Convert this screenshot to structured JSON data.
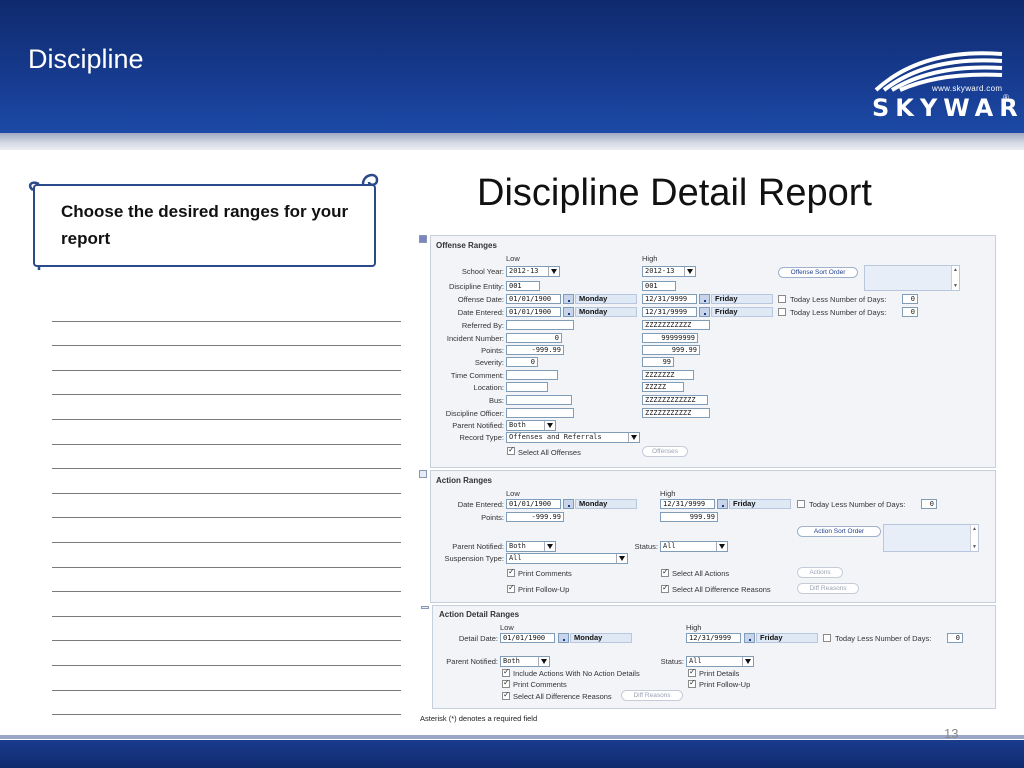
{
  "slide": {
    "title": "Discipline",
    "heading": "Discipline Detail Report",
    "callout": "Choose the desired ranges for your report",
    "page_number": "13",
    "note_line_count": 17,
    "colors": {
      "header": "#183e95",
      "accent": "#2a4a8a"
    }
  },
  "logo": {
    "url": "www.skyward.com",
    "name": "SKYWARD",
    "reg": "®"
  },
  "offense_ranges": {
    "title": "Offense Ranges",
    "low_header": "Low",
    "high_header": "High",
    "fields": {
      "school_year": {
        "label": "School Year:",
        "low": "2012-13",
        "high": "2012-13"
      },
      "discipline_entity": {
        "label": "Discipline Entity:",
        "low": "001",
        "high": "001"
      },
      "offense_date": {
        "label": "Offense Date:",
        "low": "01/01/1900",
        "low_day": "Monday",
        "high": "12/31/9999",
        "high_day": "Friday"
      },
      "date_entered": {
        "label": "Date Entered:",
        "low": "01/01/1900",
        "low_day": "Monday",
        "high": "12/31/9999",
        "high_day": "Friday"
      },
      "referred_by": {
        "label": "Referred By:",
        "low": "",
        "high": "ZZZZZZZZZZZ"
      },
      "incident_number": {
        "label": "Incident Number:",
        "low": "0",
        "high": "99999999"
      },
      "points": {
        "label": "Points:",
        "low": "-999.99",
        "high": "999.99"
      },
      "severity": {
        "label": "Severity:",
        "low": "0",
        "high": "99"
      },
      "time_comment": {
        "label": "Time Comment:",
        "low": "",
        "high": "ZZZZZZZ"
      },
      "location": {
        "label": "Location:",
        "low": "",
        "high": "ZZZZZ"
      },
      "bus": {
        "label": "Bus:",
        "low": "",
        "high": "ZZZZZZZZZZZZ"
      },
      "discipline_officer": {
        "label": "Discipline Officer:",
        "low": "",
        "high": "ZZZZZZZZZZZ"
      },
      "parent_notified": {
        "label": "Parent Notified:",
        "value": "Both"
      },
      "record_type": {
        "label": "Record Type:",
        "value": "Offenses and Referrals"
      }
    },
    "today_less_label": "Today Less Number of Days:",
    "today_less_offense": "0",
    "today_less_entered": "0",
    "sort_button": "Offense Sort Order",
    "select_all_label": "Select All Offenses",
    "offenses_button": "Offenses"
  },
  "action_ranges": {
    "title": "Action Ranges",
    "low_header": "Low",
    "high_header": "High",
    "date_entered": {
      "label": "Date Entered:",
      "low": "01/01/1900",
      "low_day": "Monday",
      "high": "12/31/9999",
      "high_day": "Friday"
    },
    "points": {
      "label": "Points:",
      "low": "-999.99",
      "high": "999.99"
    },
    "today_less_label": "Today Less Number of Days:",
    "today_less": "0",
    "sort_button": "Action Sort Order",
    "parent_notified": {
      "label": "Parent Notified:",
      "value": "Both"
    },
    "status": {
      "label": "Status:",
      "value": "All"
    },
    "suspension_type": {
      "label": "Suspension Type:",
      "value": "All"
    },
    "print_comments": "Print Comments",
    "print_follow_up": "Print Follow-Up",
    "select_all_actions": "Select All Actions",
    "select_all_diff": "Select All Difference Reasons",
    "actions_button": "Actions",
    "diff_button": "Diff Reasons"
  },
  "action_detail_ranges": {
    "title": "Action Detail Ranges",
    "low_header": "Low",
    "high_header": "High",
    "detail_date": {
      "label": "Detail Date:",
      "low": "01/01/1900",
      "low_day": "Monday",
      "high": "12/31/9999",
      "high_day": "Friday"
    },
    "today_less_label": "Today Less Number of Days:",
    "today_less": "0",
    "parent_notified": {
      "label": "Parent Notified:",
      "value": "Both"
    },
    "status": {
      "label": "Status:",
      "value": "All"
    },
    "include_no_details": "Include Actions With No Action Details",
    "print_comments": "Print Comments",
    "select_all_diff": "Select All Difference Reasons",
    "diff_button": "Diff Reasons",
    "print_details": "Print Details",
    "print_follow_up": "Print Follow-Up"
  },
  "footnote": "Asterisk (*) denotes a required field"
}
